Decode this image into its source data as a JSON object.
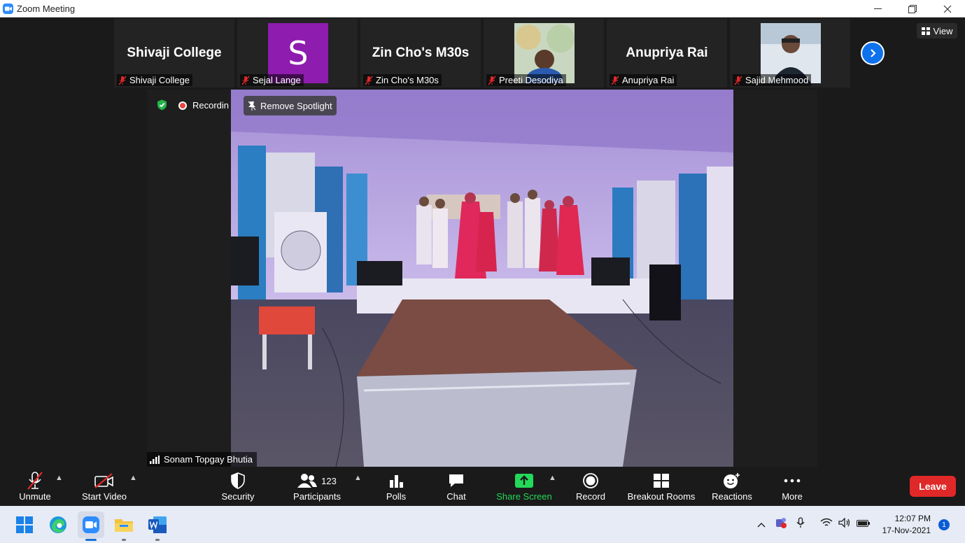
{
  "window": {
    "title": "Zoom Meeting"
  },
  "view_button": {
    "label": "View"
  },
  "thumbnails": [
    {
      "display": "Shivaji College",
      "name": "Shivaji College"
    },
    {
      "avatar_letter": "S",
      "name": "Sejal Lange"
    },
    {
      "display": "Zin Cho's M30s",
      "name": "Zin Cho's M30s"
    },
    {
      "name": "Preeti Desodiya"
    },
    {
      "display": "Anupriya Rai",
      "name": "Anupriya Rai"
    },
    {
      "name": "Sajid Mehmood"
    }
  ],
  "spotlight": {
    "recording_label": "Recordin",
    "remove_spotlight": "Remove Spotlight",
    "speaker": "Sonam Topgay Bhutia"
  },
  "toolbar": {
    "unmute": "Unmute",
    "start_video": "Start Video",
    "security": "Security",
    "participants": "Participants",
    "participant_count": "123",
    "polls": "Polls",
    "chat": "Chat",
    "share_screen": "Share Screen",
    "record": "Record",
    "breakout_rooms": "Breakout Rooms",
    "reactions": "Reactions",
    "more": "More",
    "leave": "Leave"
  },
  "taskbar": {
    "time": "12:07 PM",
    "date": "17-Nov-2021",
    "notification_count": "1"
  },
  "colors": {
    "zoom_blue": "#0e72ed",
    "share_green": "#23d959",
    "leave_red": "#e02828",
    "avatar_purple": "#8e1cae"
  }
}
